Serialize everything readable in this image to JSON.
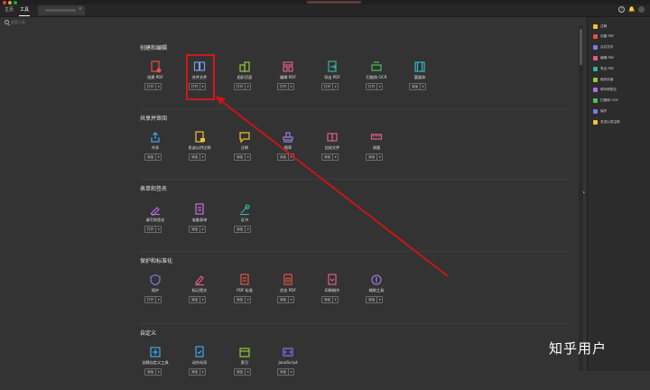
{
  "tabs": {
    "home": "主页",
    "tools": "工具"
  },
  "search": {
    "placeholder": "搜索工具"
  },
  "sections": [
    {
      "title": "创建和编辑",
      "tools": [
        {
          "label": "创建 PDF",
          "action": "打开",
          "icon": "create-pdf-icon",
          "color": "#e8504b"
        },
        {
          "label": "合并文件",
          "action": "打开",
          "icon": "combine-files-icon",
          "color": "#7a9be8"
        },
        {
          "label": "组织页面",
          "action": "打开",
          "icon": "organize-pages-icon",
          "color": "#94c93b"
        },
        {
          "label": "编辑 PDF",
          "action": "打开",
          "icon": "edit-pdf-icon",
          "color": "#e05f80"
        },
        {
          "label": "导出 PDF",
          "action": "打开",
          "icon": "export-pdf-icon",
          "color": "#33b3a0"
        },
        {
          "label": "扫描和 OCR",
          "action": "打开",
          "icon": "scan-ocr-icon",
          "color": "#4fbf57"
        },
        {
          "label": "富媒体",
          "action": "添加",
          "icon": "rich-media-icon",
          "color": "#30b8c9"
        }
      ]
    },
    {
      "title": "共享并审阅",
      "tools": [
        {
          "label": "共享",
          "action": "添加",
          "icon": "share-icon",
          "color": "#3ea9e8"
        },
        {
          "label": "发送以供注释",
          "action": "添加",
          "icon": "send-for-comments-icon",
          "color": "#f2c230"
        },
        {
          "label": "注释",
          "action": "添加",
          "icon": "comment-icon",
          "color": "#f2c230"
        },
        {
          "label": "图章",
          "action": "添加",
          "icon": "stamp-icon",
          "color": "#9a7be0"
        },
        {
          "label": "比较文件",
          "action": "添加",
          "icon": "compare-files-icon",
          "color": "#e05f80"
        },
        {
          "label": "测量",
          "action": "添加",
          "icon": "measure-icon",
          "color": "#e05f80"
        }
      ]
    },
    {
      "title": "表单和签名",
      "tools": [
        {
          "label": "填写和签名",
          "action": "打开",
          "icon": "fill-sign-icon",
          "color": "#b46ae0"
        },
        {
          "label": "准备表单",
          "action": "添加",
          "icon": "prepare-form-icon",
          "color": "#c770e0"
        },
        {
          "label": "证书",
          "action": "添加",
          "icon": "certificates-icon",
          "color": "#33b3a0"
        }
      ]
    },
    {
      "title": "保护和标准化",
      "tools": [
        {
          "label": "保护",
          "action": "打开",
          "icon": "protect-icon",
          "color": "#7a7be8"
        },
        {
          "label": "标记密文",
          "action": "添加",
          "icon": "redact-icon",
          "color": "#e05f80"
        },
        {
          "label": "PDF 标准",
          "action": "添加",
          "icon": "pdf-standards-icon",
          "color": "#e8504b"
        },
        {
          "label": "优化 PDF",
          "action": "添加",
          "icon": "optimize-pdf-icon",
          "color": "#e8504b"
        },
        {
          "label": "印刷制作",
          "action": "添加",
          "icon": "print-production-icon",
          "color": "#e05f80"
        },
        {
          "label": "辅助工具",
          "action": "添加",
          "icon": "accessibility-icon",
          "color": "#9a7be0"
        }
      ]
    },
    {
      "title": "自定义",
      "tools": [
        {
          "label": "创建自定义工具",
          "action": "添加",
          "icon": "custom-tool-icon",
          "color": "#3ea9e8"
        },
        {
          "label": "动作向导",
          "action": "添加",
          "icon": "action-wizard-icon",
          "color": "#3ea9e8"
        },
        {
          "label": "索引",
          "action": "添加",
          "icon": "index-icon",
          "color": "#94c93b"
        },
        {
          "label": "JavaScript",
          "action": "添加",
          "icon": "javascript-icon",
          "color": "#7a7be8"
        }
      ]
    }
  ],
  "right_panel": [
    {
      "label": "注释",
      "color": "#f2c230"
    },
    {
      "label": "创建 PDF",
      "color": "#e8504b"
    },
    {
      "label": "合并文件",
      "color": "#7a7be8"
    },
    {
      "label": "编辑 PDF",
      "color": "#e05f80"
    },
    {
      "label": "导出 PDF",
      "color": "#33b3a0"
    },
    {
      "label": "组织页面",
      "color": "#94c93b"
    },
    {
      "label": "填写和签名",
      "color": "#b46ae0"
    },
    {
      "label": "扫描和 OCR",
      "color": "#4fbf57"
    },
    {
      "label": "保护",
      "color": "#7a7be8"
    },
    {
      "label": "发送以供注释",
      "color": "#f2c230"
    }
  ],
  "watermark": "知乎用户",
  "accent": "#d21818"
}
